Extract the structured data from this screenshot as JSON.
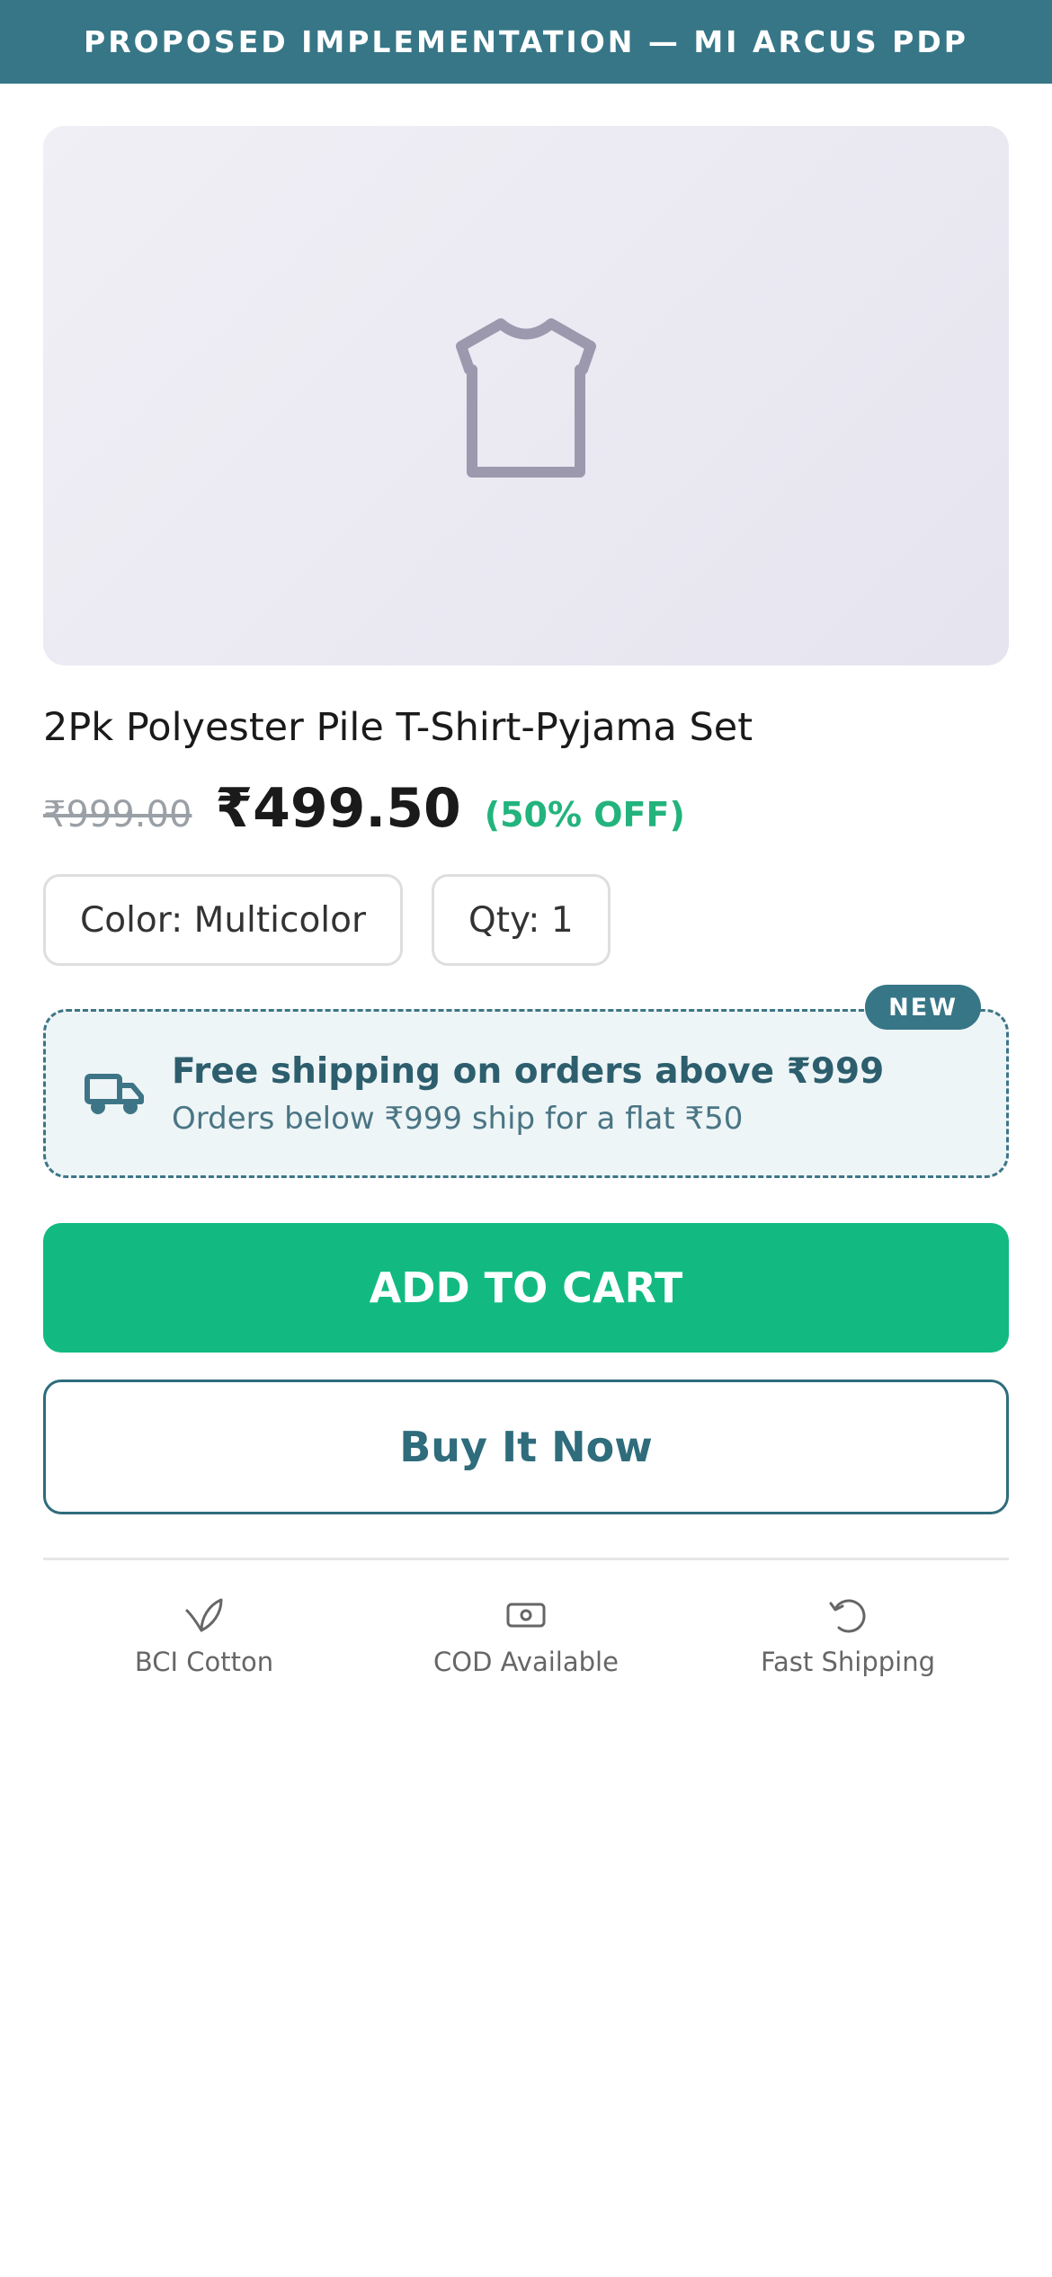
{
  "banner": {
    "title": "PROPOSED IMPLEMENTATION — MI ARCUS PDP"
  },
  "product": {
    "image_icon": "tshirt-icon",
    "title": "2Pk Polyester Pile T-Shirt-Pyjama Set",
    "price_original": "₹999.00",
    "price_current": "₹499.50",
    "discount": "(50% OFF)"
  },
  "options": {
    "color": "Color: Multicolor",
    "qty": "Qty: 1"
  },
  "shipping": {
    "badge": "NEW",
    "icon": "truck-icon",
    "headline": "Free shipping on orders above ₹999",
    "sub": "Orders below ₹999 ship for a flat ₹50"
  },
  "actions": {
    "add_to_cart": "ADD TO CART",
    "buy_now": "Buy It Now"
  },
  "features": [
    {
      "icon": "leaf-icon",
      "label": "BCI Cotton"
    },
    {
      "icon": "cash-icon",
      "label": "COD Available"
    },
    {
      "icon": "refresh-icon",
      "label": "Fast Shipping"
    }
  ],
  "colors": {
    "banner": "#367687",
    "accent_green": "#12ba82",
    "discount_green": "#23b37d",
    "teal_text": "#2f6c7c"
  }
}
